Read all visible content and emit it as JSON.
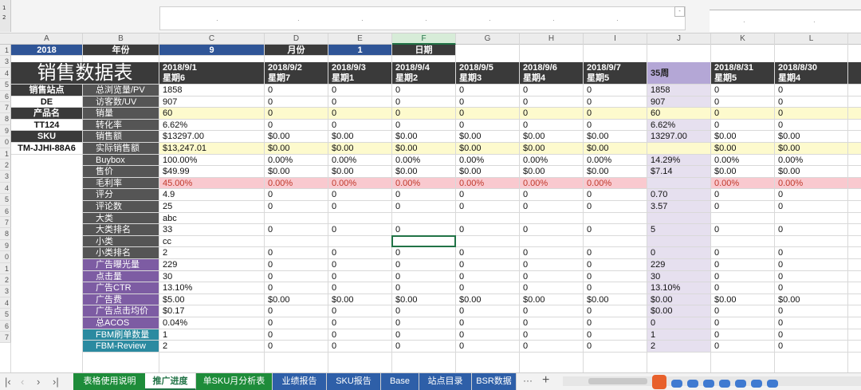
{
  "topbar": {
    "namebox_glyphs": [
      "1",
      "2"
    ],
    "dropdown_glyph": "-"
  },
  "column_headers": [
    "A",
    "B",
    "C",
    "D",
    "E",
    "F",
    "G",
    "H",
    "I",
    "J",
    "K",
    "L"
  ],
  "selected_column": "F",
  "row_numbers": [
    "1",
    "3",
    "4",
    "5",
    "6",
    "7",
    "8",
    "9",
    "0",
    "1",
    "2",
    "3",
    "4",
    "5",
    "6",
    "7",
    "8",
    "9",
    "0",
    "1",
    "2",
    "3",
    "4",
    "5",
    "6",
    "7"
  ],
  "header_row": {
    "year": "2018",
    "year_label": "年份",
    "month": "9",
    "month_label": "月份",
    "day": "1",
    "day_label": "日期"
  },
  "title": "销售数据表",
  "left_panel": [
    {
      "label": "销售站点",
      "value": "DE"
    },
    {
      "label": "产品名",
      "value": "TT124"
    },
    {
      "label": "SKU",
      "value": "TM-JJHI-88A6"
    }
  ],
  "date_columns": [
    {
      "date": "2018/9/1",
      "week": "星期6"
    },
    {
      "date": "2018/9/2",
      "week": "星期7"
    },
    {
      "date": "2018/9/3",
      "week": "星期1"
    },
    {
      "date": "2018/9/4",
      "week": "星期2"
    },
    {
      "date": "2018/9/5",
      "week": "星期3"
    },
    {
      "date": "2018/9/6",
      "week": "星期4"
    },
    {
      "date": "2018/9/7",
      "week": "星期5"
    },
    {
      "date": "35周",
      "week": ""
    },
    {
      "date": "2018/8/31",
      "week": "星期5"
    },
    {
      "date": "2018/8/30",
      "week": "星期4"
    }
  ],
  "metrics": [
    {
      "name": "总浏览量/PV",
      "group": "gray",
      "values": [
        "1858",
        "0",
        "0",
        "0",
        "0",
        "0",
        "0",
        "1858",
        "0",
        "0"
      ]
    },
    {
      "name": "访客数/UV",
      "group": "gray",
      "values": [
        "907",
        "0",
        "0",
        "0",
        "0",
        "0",
        "0",
        "907",
        "0",
        "0"
      ]
    },
    {
      "name": "销量",
      "group": "gray",
      "highlight": "yellow",
      "values": [
        "60",
        "0",
        "0",
        "0",
        "0",
        "0",
        "0",
        "60",
        "0",
        "0"
      ]
    },
    {
      "name": "转化率",
      "group": "gray",
      "values": [
        "6.62%",
        "0",
        "0",
        "0",
        "0",
        "0",
        "0",
        "6.62%",
        "0",
        "0"
      ]
    },
    {
      "name": "销售额",
      "group": "gray",
      "values": [
        "$13297.00",
        "$0.00",
        "$0.00",
        "$0.00",
        "$0.00",
        "$0.00",
        "$0.00",
        "13297.00",
        "$0.00",
        "$0.00"
      ]
    },
    {
      "name": "实际销售额",
      "group": "gray",
      "highlight": "yellow",
      "values": [
        "$13,247.01",
        "$0.00",
        "$0.00",
        "$0.00",
        "$0.00",
        "$0.00",
        "$0.00",
        "",
        "$0.00",
        "$0.00"
      ]
    },
    {
      "name": "Buybox",
      "group": "gray",
      "values": [
        "100.00%",
        "0.00%",
        "0.00%",
        "0.00%",
        "0.00%",
        "0.00%",
        "0.00%",
        "14.29%",
        "0.00%",
        "0.00%"
      ]
    },
    {
      "name": "售价",
      "group": "gray",
      "values": [
        "$49.99",
        "$0.00",
        "$0.00",
        "$0.00",
        "$0.00",
        "$0.00",
        "$0.00",
        "$7.14",
        "$0.00",
        "$0.00"
      ]
    },
    {
      "name": "毛利率",
      "group": "gray",
      "highlight": "pink",
      "values": [
        "45.00%",
        "0.00%",
        "0.00%",
        "0.00%",
        "0.00%",
        "0.00%",
        "0.00%",
        "",
        "0.00%",
        "0.00%"
      ]
    },
    {
      "name": "评分",
      "group": "gray",
      "values": [
        "4.9",
        "0",
        "0",
        "0",
        "0",
        "0",
        "0",
        "0.70",
        "0",
        "0"
      ]
    },
    {
      "name": "评论数",
      "group": "gray",
      "values": [
        "25",
        "0",
        "0",
        "0",
        "0",
        "0",
        "0",
        "3.57",
        "0",
        "0"
      ]
    },
    {
      "name": "大类",
      "group": "gray",
      "values": [
        "abc",
        "",
        "",
        "",
        "",
        "",
        "",
        "",
        "",
        ""
      ]
    },
    {
      "name": "大类排名",
      "group": "gray",
      "values": [
        "33",
        "0",
        "0",
        "0",
        "0",
        "0",
        "0",
        "5",
        "0",
        "0"
      ]
    },
    {
      "name": "小类",
      "group": "gray",
      "values": [
        "cc",
        "",
        "",
        "",
        "",
        "",
        "",
        "",
        "",
        ""
      ]
    },
    {
      "name": "小类排名",
      "group": "gray",
      "values": [
        "2",
        "0",
        "0",
        "0",
        "0",
        "0",
        "0",
        "0",
        "0",
        "0"
      ]
    },
    {
      "name": "广告曝光量",
      "group": "purple",
      "values": [
        "229",
        "0",
        "0",
        "0",
        "0",
        "0",
        "0",
        "229",
        "0",
        "0"
      ]
    },
    {
      "name": "点击量",
      "group": "purple",
      "values": [
        "30",
        "0",
        "0",
        "0",
        "0",
        "0",
        "0",
        "30",
        "0",
        "0"
      ]
    },
    {
      "name": "广告CTR",
      "group": "purple",
      "values": [
        "13.10%",
        "0",
        "0",
        "0",
        "0",
        "0",
        "0",
        "13.10%",
        "0",
        "0"
      ]
    },
    {
      "name": "广告费",
      "group": "purple",
      "values": [
        "$5.00",
        "$0.00",
        "$0.00",
        "$0.00",
        "$0.00",
        "$0.00",
        "$0.00",
        "$0.00",
        "$0.00",
        "$0.00"
      ]
    },
    {
      "name": "广告点击均价",
      "group": "purple",
      "values": [
        "$0.17",
        "0",
        "0",
        "0",
        "0",
        "0",
        "0",
        "$0.00",
        "0",
        "0"
      ]
    },
    {
      "name": "总ACOS",
      "group": "purple",
      "values": [
        "0.04%",
        "0",
        "0",
        "0",
        "0",
        "0",
        "0",
        "0",
        "0",
        "0"
      ]
    },
    {
      "name": "FBM刷单数量",
      "group": "teal",
      "values": [
        "1",
        "0",
        "0",
        "0",
        "0",
        "0",
        "0",
        "1",
        "0",
        "0"
      ]
    },
    {
      "name": "FBM-Review",
      "group": "teal",
      "values": [
        "2",
        "0",
        "0",
        "0",
        "0",
        "0",
        "0",
        "2",
        "0",
        "0"
      ]
    }
  ],
  "sheet_tabs": [
    {
      "label": "表格使用说明",
      "color": "#1e8c3a"
    },
    {
      "label": "推广进度",
      "color": "#ffffff",
      "active": true
    },
    {
      "label": "单SKU月分析表",
      "color": "#1e8c3a"
    },
    {
      "label": "业绩报告",
      "color": "#2e5fa8"
    },
    {
      "label": "SKU报告",
      "color": "#2e5fa8"
    },
    {
      "label": "Base",
      "color": "#2e5fa8"
    },
    {
      "label": "站点目录",
      "color": "#2e5fa8"
    },
    {
      "label": "BSR数据跟踪",
      "color": "#2e5fa8"
    }
  ],
  "tab_controls": {
    "prev_first": "|<",
    "prev": "<",
    "next": ">",
    "last": ">|",
    "more": "···",
    "add": "+"
  },
  "colors": {
    "dark": "#3a3a3a",
    "gray_label": "#555555",
    "purple_label": "#7d5ca3",
    "teal_label": "#2b8aa0",
    "yellow": "#fdfacd",
    "pink": "#f9c9cf",
    "lavender": "#e6e0ef",
    "blue_header": "#2f5597",
    "week_header": "#b4a7d6"
  }
}
